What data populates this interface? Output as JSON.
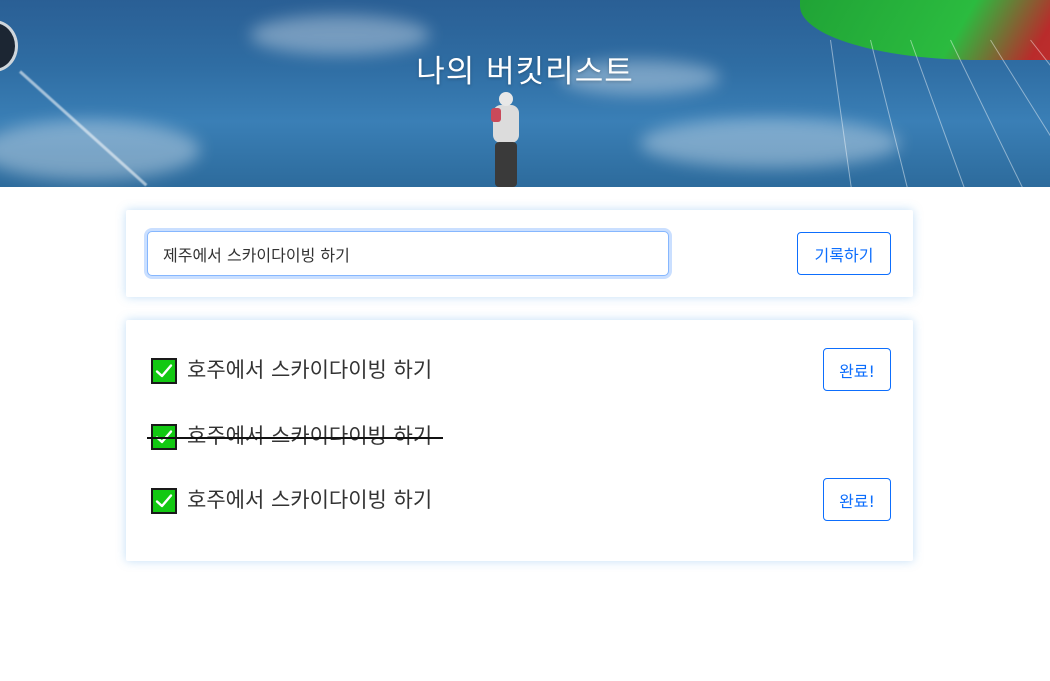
{
  "header": {
    "title": "나의 버킷리스트"
  },
  "form": {
    "input_value": "제주에서 스카이다이빙 하기",
    "submit_label": "기록하기"
  },
  "bucket_list": {
    "items": [
      {
        "text": "호주에서 스카이다이빙 하기",
        "done": false,
        "button_label": "완료!"
      },
      {
        "text": "호주에서 스카이다이빙 하기",
        "done": true
      },
      {
        "text": "호주에서 스카이다이빙 하기",
        "done": false,
        "button_label": "완료!"
      }
    ]
  },
  "colors": {
    "accent": "#0d6efd",
    "check": "#12c912"
  },
  "icons": {
    "check": "checkmark-icon"
  }
}
